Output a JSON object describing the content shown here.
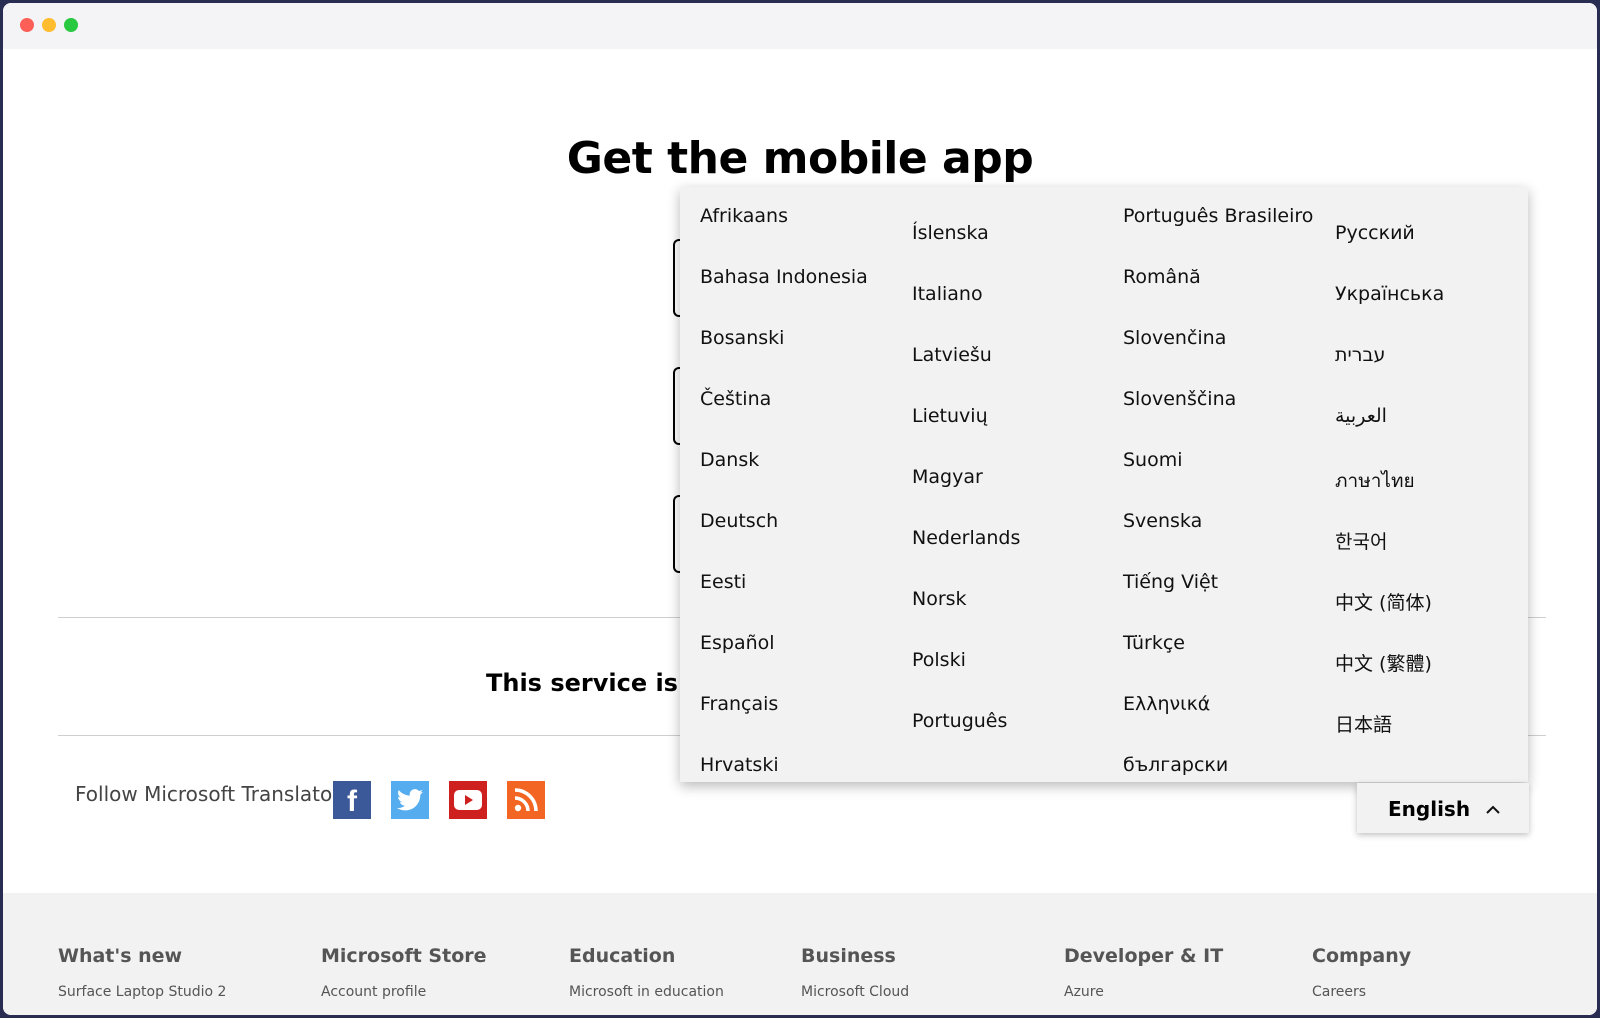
{
  "page": {
    "title": "Get the mobile app",
    "service_text": "This service is p"
  },
  "follow": {
    "label": "Follow Microsoft Translator",
    "icons": [
      "facebook-icon",
      "twitter-icon",
      "youtube-icon",
      "rss-icon"
    ],
    "colors": {
      "facebook": "#3b5998",
      "twitter": "#55acee",
      "youtube": "#cd201f",
      "rss": "#f26522"
    }
  },
  "language_menu": {
    "columns": [
      [
        "Afrikaans",
        "Bahasa Indonesia",
        "Bosanski",
        "Čeština",
        "Dansk",
        "Deutsch",
        "Eesti",
        "Español",
        "Français",
        "Hrvatski"
      ],
      [
        "Íslenska",
        "Italiano",
        "Latviešu",
        "Lietuvių",
        "Magyar",
        "Nederlands",
        "Norsk",
        "Polski",
        "Português"
      ],
      [
        "Português Brasileiro",
        "Română",
        "Slovenčina",
        "Slovenščina",
        "Suomi",
        "Svenska",
        "Tiếng Việt",
        "Türkçe",
        "Ελληνικά",
        "български"
      ],
      [
        "Русский",
        "Українська",
        "עברית",
        "العربية",
        "ภาษาไทย",
        "한국어",
        "中文 (简体)",
        "中文 (繁體)",
        "日本語"
      ]
    ],
    "selected": "English",
    "state": "expanded"
  },
  "footer": {
    "columns": [
      {
        "heading": "What's new",
        "link": "Surface Laptop Studio 2"
      },
      {
        "heading": "Microsoft Store",
        "link": "Account profile"
      },
      {
        "heading": "Education",
        "link": "Microsoft in education"
      },
      {
        "heading": "Business",
        "link": "Microsoft Cloud"
      },
      {
        "heading": "Developer & IT",
        "link": "Azure"
      },
      {
        "heading": "Company",
        "link": "Careers"
      }
    ]
  }
}
